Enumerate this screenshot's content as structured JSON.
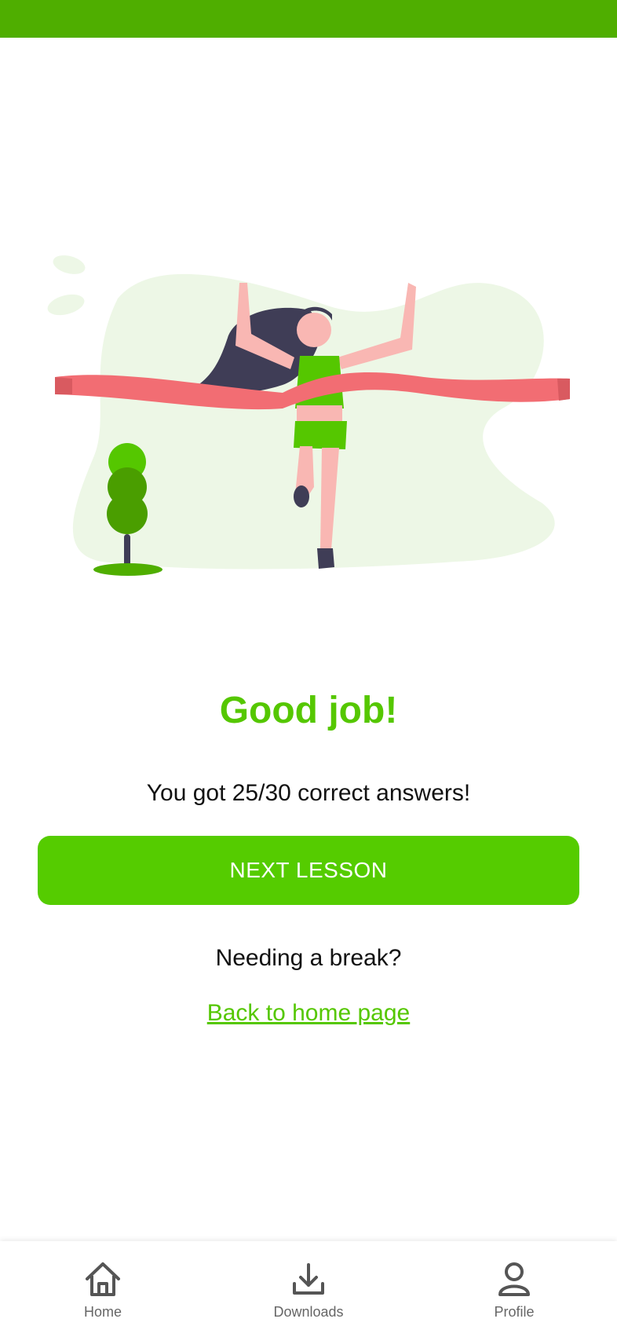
{
  "colors": {
    "status_bar": "#4fae00",
    "accent": "#55c700",
    "button": "#55cc00",
    "ribbon": "#f26d73",
    "blob": "#edf7e6",
    "hair": "#3f3d56",
    "skin": "#f9b7b3",
    "outfit": "#55c700",
    "tree_dark": "#4a9e00"
  },
  "result": {
    "title": "Good job!",
    "score_text": "You got 25/30 correct answers!"
  },
  "actions": {
    "next_label": "NEXT LESSON",
    "break_text": "Needing a break?",
    "home_link": "Back to home page"
  },
  "nav": {
    "items": [
      {
        "label": "Home",
        "icon": "home-icon"
      },
      {
        "label": "Downloads",
        "icon": "download-icon"
      },
      {
        "label": "Profile",
        "icon": "profile-icon"
      }
    ]
  }
}
